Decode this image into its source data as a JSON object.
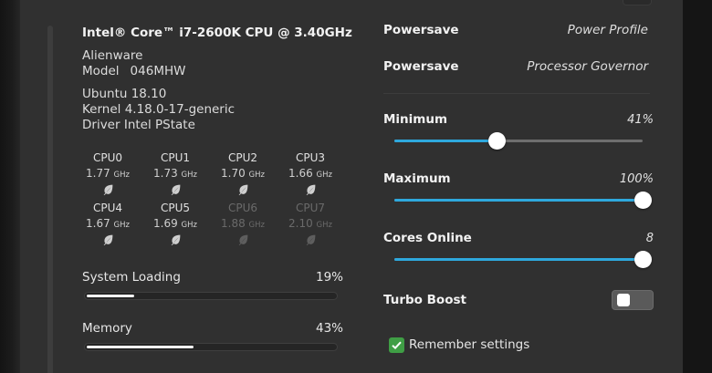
{
  "colors": {
    "accent": "#2ea8dd",
    "panel": "#303030",
    "checkbox": "#3f9e45"
  },
  "system": {
    "cpu_name": "Intel® Core™ i7-2600K CPU @ 3.40GHz",
    "vendor": "Alienware",
    "model_label": "Model",
    "model_value": "046MHW",
    "os": "Ubuntu 18.10",
    "kernel": "Kernel 4.18.0-17-generic",
    "driver": "Driver Intel PState"
  },
  "cores": [
    {
      "name": "CPU0",
      "freq": "1.77",
      "unit": "GHz",
      "online": true
    },
    {
      "name": "CPU1",
      "freq": "1.73",
      "unit": "GHz",
      "online": true
    },
    {
      "name": "CPU2",
      "freq": "1.70",
      "unit": "GHz",
      "online": true
    },
    {
      "name": "CPU3",
      "freq": "1.66",
      "unit": "GHz",
      "online": true
    },
    {
      "name": "CPU4",
      "freq": "1.67",
      "unit": "GHz",
      "online": true
    },
    {
      "name": "CPU5",
      "freq": "1.69",
      "unit": "GHz",
      "online": true
    },
    {
      "name": "CPU6",
      "freq": "1.88",
      "unit": "GHz",
      "online": false
    },
    {
      "name": "CPU7",
      "freq": "2.10",
      "unit": "GHz",
      "online": false
    }
  ],
  "meters": {
    "load": {
      "label": "System Loading",
      "value": "19%",
      "fraction": 0.19
    },
    "memory": {
      "label": "Memory",
      "value": "43%",
      "fraction": 0.43
    }
  },
  "profile": {
    "power_profile_label": "Powersave",
    "power_profile_caption": "Power Profile",
    "governor_label": "Powersave",
    "governor_caption": "Processor Governor"
  },
  "sliders": {
    "minimum": {
      "label": "Minimum",
      "value": "41%",
      "fraction": 0.41
    },
    "maximum": {
      "label": "Maximum",
      "value": "100%",
      "fraction": 1.0
    },
    "cores_online": {
      "label": "Cores Online",
      "value": "8",
      "fraction": 1.0
    }
  },
  "turbo": {
    "label": "Turbo Boost",
    "on": false
  },
  "remember": {
    "label": "Remember settings",
    "checked": true
  }
}
